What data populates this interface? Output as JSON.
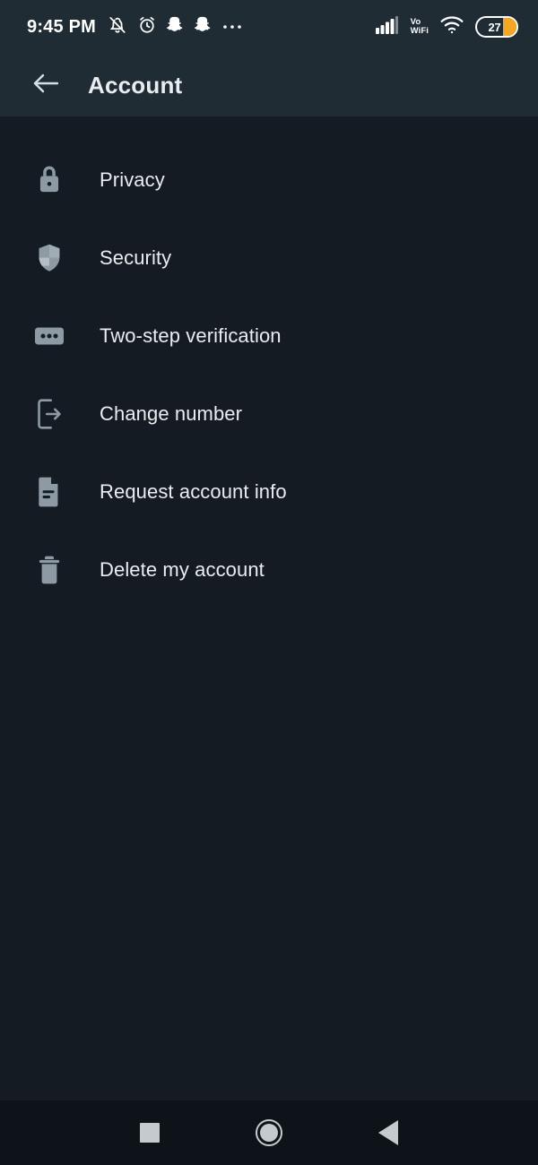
{
  "status_bar": {
    "time": "9:45 PM",
    "icons": [
      "bell-slash-icon",
      "alarm-clock-icon",
      "snapchat-icon",
      "snapchat-icon",
      "more-dots-icon"
    ],
    "network_label_line1": "Vo",
    "network_label_line2": "WiFi",
    "battery_percent": "27",
    "battery_fill_color": "#f5a623",
    "signal_icon": "cellular-signal-icon",
    "wifi_icon": "wifi-icon",
    "background_color": "#1f2c34"
  },
  "app_bar": {
    "back_icon": "arrow-left-icon",
    "title": "Account",
    "background_color": "#1f2c34",
    "title_color": "#e9edef"
  },
  "settings_list": {
    "background_color": "#141b22",
    "icon_color": "#8d9aa3",
    "label_color": "#e9edef",
    "items": [
      {
        "icon": "lock-icon",
        "label": "Privacy"
      },
      {
        "icon": "shield-icon",
        "label": "Security"
      },
      {
        "icon": "two-step-dots-icon",
        "label": "Two-step verification"
      },
      {
        "icon": "change-number-icon",
        "label": "Change number"
      },
      {
        "icon": "document-icon",
        "label": "Request account info"
      },
      {
        "icon": "trash-icon",
        "label": "Delete my account"
      }
    ]
  },
  "nav_bar": {
    "background_color": "#0d1319",
    "glyph_color": "#c4cace",
    "buttons": [
      {
        "name": "recents-button",
        "icon": "square-icon"
      },
      {
        "name": "home-button",
        "icon": "circle-icon"
      },
      {
        "name": "back-button",
        "icon": "triangle-left-icon"
      }
    ]
  }
}
